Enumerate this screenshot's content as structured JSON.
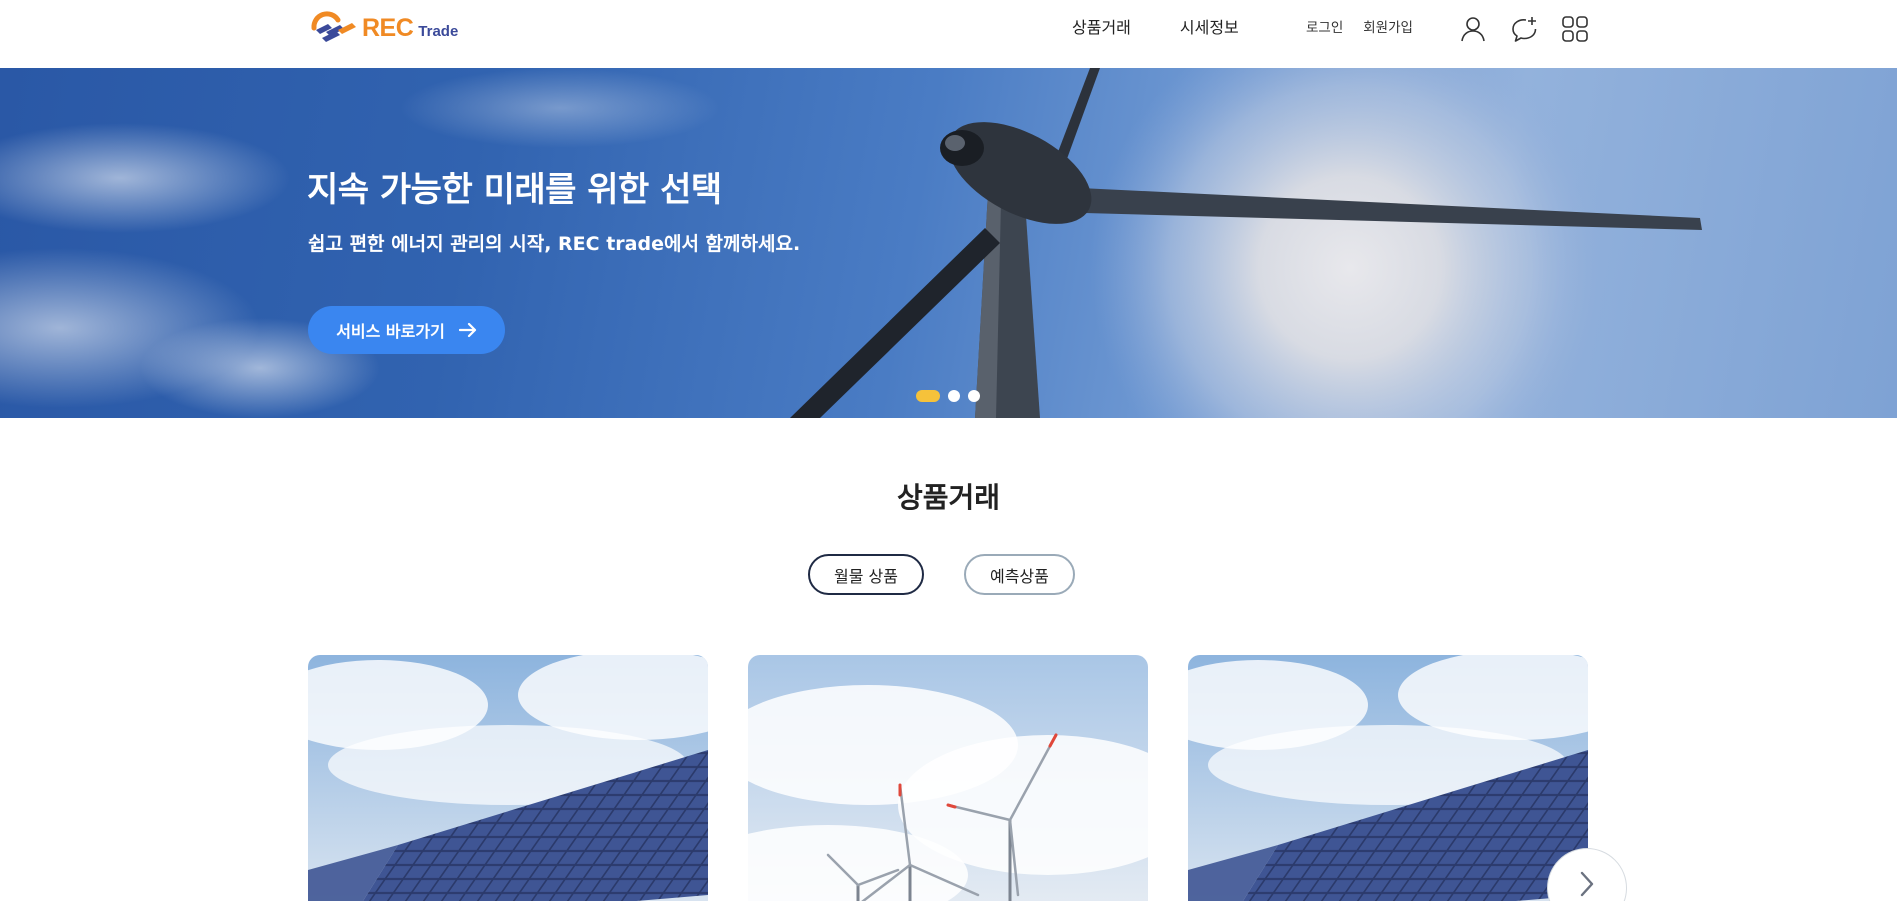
{
  "header": {
    "logo": {
      "rec": "REC",
      "trade": "Trade"
    },
    "nav_main": [
      "상품거래",
      "시세정보"
    ],
    "nav_sub": {
      "login": "로그인",
      "signup": "회원가입"
    },
    "icons": [
      "user-icon",
      "chat-plus-icon",
      "grid-menu-icon"
    ]
  },
  "hero": {
    "title": "지속 가능한 미래를 위한 선택",
    "subtitle": "쉽고 편한 에너지 관리의 시작, REC trade에서 함께하세요.",
    "button_label": "서비스 바로가기",
    "slide_count": 3,
    "active_slide": 1
  },
  "products": {
    "title": "상품거래",
    "tabs": [
      {
        "label": "월물 상품",
        "active": true
      },
      {
        "label": "예측상품",
        "active": false
      }
    ],
    "cards": [
      {
        "image": "solar-panel-image"
      },
      {
        "image": "wind-turbine-image"
      },
      {
        "image": "solar-panel-image"
      }
    ]
  },
  "colors": {
    "accent": "#3a86f0",
    "active_dot": "#f6c23a",
    "logo_orange": "#f08a24",
    "logo_blue": "#3b4a9a",
    "tab_active_border": "#1f2a44"
  }
}
